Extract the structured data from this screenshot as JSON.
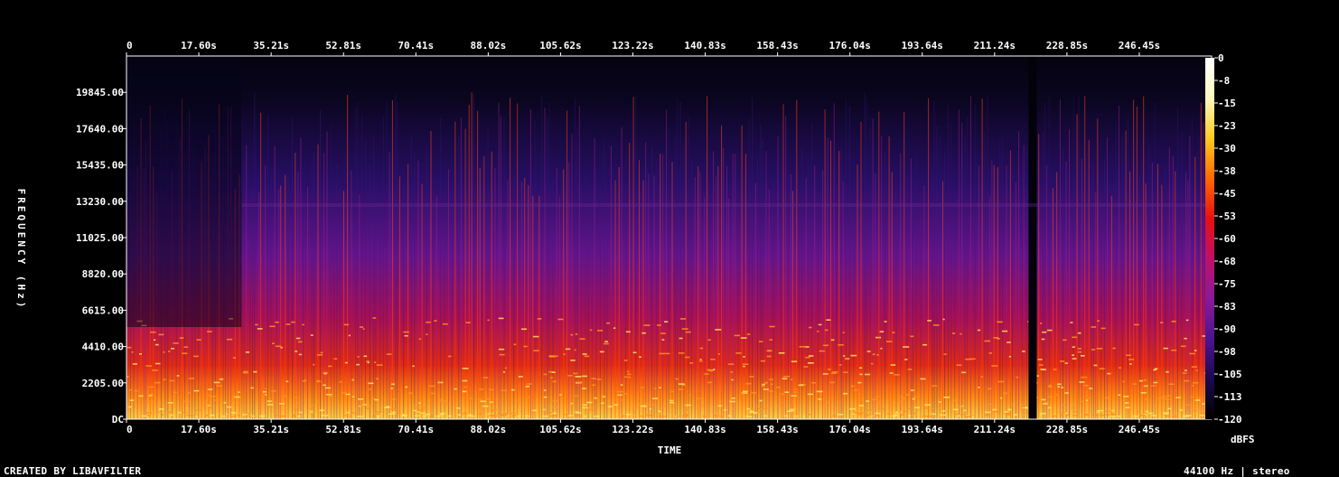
{
  "footer": {
    "credit": "CREATED BY LIBAVFILTER",
    "info": "44100 Hz | stereo"
  },
  "chart_data": {
    "type": "heatmap",
    "title": "",
    "xlabel": "TIME",
    "ylabel": "FREQUENCY (Hz)",
    "x_ticks": [
      "0",
      "17.60s",
      "35.21s",
      "52.81s",
      "70.41s",
      "88.02s",
      "105.62s",
      "123.22s",
      "140.83s",
      "158.43s",
      "176.04s",
      "193.64s",
      "211.24s",
      "228.85s",
      "246.45s"
    ],
    "x_tick_values": [
      0,
      17.6,
      35.21,
      52.81,
      70.41,
      88.02,
      105.62,
      123.22,
      140.83,
      158.43,
      176.04,
      193.64,
      211.24,
      228.85,
      246.45
    ],
    "xlim": [
      0,
      264.05
    ],
    "y_ticks": [
      "DC",
      "2205.00",
      "4410.00",
      "6615.00",
      "8820.00",
      "11025.00",
      "13230.00",
      "15435.00",
      "17640.00",
      "19845.00"
    ],
    "y_tick_values": [
      0,
      2205,
      4410,
      6615,
      8820,
      11025,
      13230,
      15435,
      17640,
      19845
    ],
    "ylim": [
      0,
      22050
    ],
    "colorbar": {
      "label": "dBFS",
      "ticks": [
        "0",
        "-8",
        "-15",
        "-23",
        "-30",
        "-38",
        "-45",
        "-53",
        "-60",
        "-68",
        "-75",
        "-83",
        "-90",
        "-98",
        "-105",
        "-113",
        "-120"
      ],
      "range": [
        -120,
        0
      ],
      "colors": [
        "#000000",
        "#1a0a50",
        "#4c1490",
        "#8a1a9a",
        "#c0106a",
        "#e81010",
        "#ff6a00",
        "#ffcc20",
        "#fff8c0",
        "#ffffff"
      ]
    },
    "quiet_gap_time": [
      219.5,
      221.5
    ],
    "intro_end_time": 28,
    "end_time": 263
  }
}
